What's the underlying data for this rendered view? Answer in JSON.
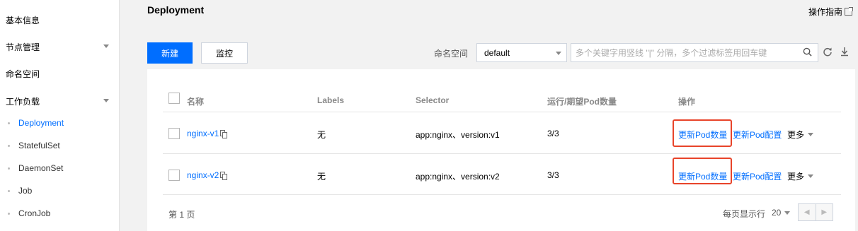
{
  "sidebar": {
    "items": [
      {
        "label": "基本信息"
      },
      {
        "label": "节点管理"
      },
      {
        "label": "命名空间"
      },
      {
        "label": "工作负载"
      }
    ],
    "workload_items": [
      {
        "label": "Deployment"
      },
      {
        "label": "StatefulSet"
      },
      {
        "label": "DaemonSet"
      },
      {
        "label": "Job"
      },
      {
        "label": "CronJob"
      }
    ]
  },
  "header": {
    "title": "Deployment",
    "guide_label": "操作指南"
  },
  "toolbar": {
    "create_label": "新建",
    "monitor_label": "监控",
    "namespace_label": "命名空间",
    "namespace_value": "default",
    "search_placeholder": "多个关键字用竖线 \"|\" 分隔，多个过滤标签用回车键"
  },
  "table": {
    "columns": [
      "名称",
      "Labels",
      "Selector",
      "运行/期望Pod数量",
      "操作"
    ],
    "rows": [
      {
        "name": "nginx-v1",
        "labels": "无",
        "selector": "app:nginx、version:v1",
        "pods": "3/3",
        "action_update_count": "更新Pod数量",
        "action_update_config": "更新Pod配置",
        "action_more": "更多"
      },
      {
        "name": "nginx-v2",
        "labels": "无",
        "selector": "app:nginx、version:v2",
        "pods": "3/3",
        "action_update_count": "更新Pod数量",
        "action_update_config": "更新Pod配置",
        "action_more": "更多"
      }
    ]
  },
  "footer": {
    "page_label": "第 1 页",
    "per_page_label": "每页显示行",
    "per_page_value": "20"
  },
  "colors": {
    "accent": "#006eff",
    "highlight": "#e8442a"
  }
}
